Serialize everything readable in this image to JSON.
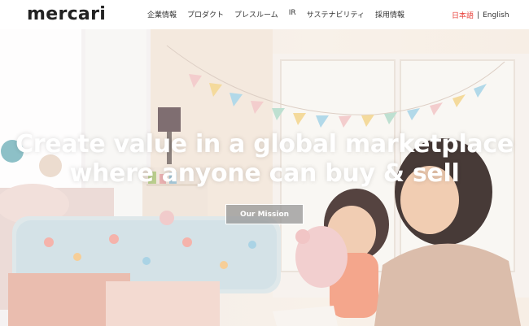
{
  "header": {
    "logo": "mercari",
    "nav": [
      "企業情報",
      "プロダクト",
      "プレスルーム",
      "IR",
      "サステナビリティ",
      "採用情報"
    ],
    "lang_ja": "日本語",
    "lang_sep": "|",
    "lang_en": "English"
  },
  "hero": {
    "title_line1": "Create value in a global marketplace",
    "title_line2": "where anyone can buy & sell",
    "button_label": "Our Mission"
  },
  "colors": {
    "accent_red": "#e8413b",
    "text_dark": "#222222",
    "button_bg": "#969696"
  }
}
